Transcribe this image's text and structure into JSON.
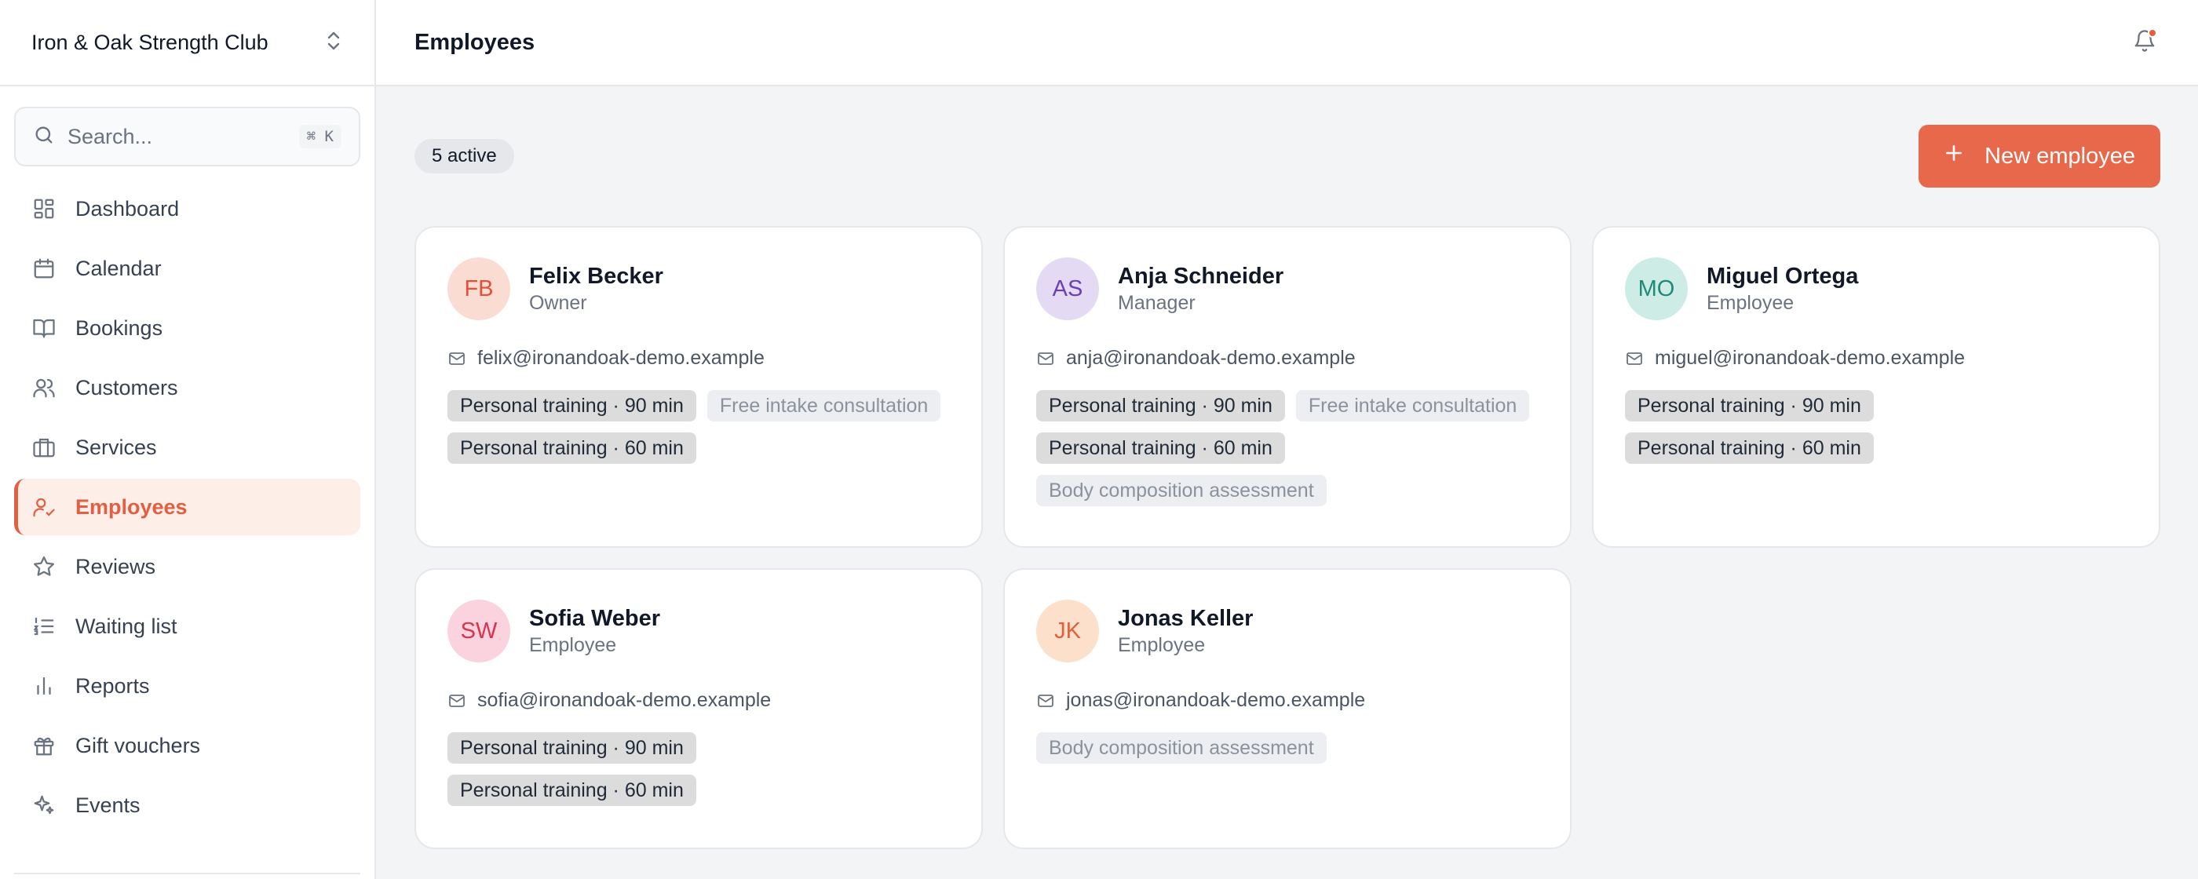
{
  "org": {
    "name": "Iron & Oak Strength Club"
  },
  "search": {
    "placeholder": "Search...",
    "shortcut": "⌘ K"
  },
  "nav": [
    {
      "label": "Dashboard",
      "icon": "dashboard-icon",
      "active": false
    },
    {
      "label": "Calendar",
      "icon": "calendar-icon",
      "active": false
    },
    {
      "label": "Bookings",
      "icon": "book-open-icon",
      "active": false
    },
    {
      "label": "Customers",
      "icon": "users-icon",
      "active": false
    },
    {
      "label": "Services",
      "icon": "briefcase-icon",
      "active": false
    },
    {
      "label": "Employees",
      "icon": "user-check-icon",
      "active": true
    },
    {
      "label": "Reviews",
      "icon": "star-icon",
      "active": false
    },
    {
      "label": "Waiting list",
      "icon": "list-ordered-icon",
      "active": false
    },
    {
      "label": "Reports",
      "icon": "bar-chart-icon",
      "active": false
    },
    {
      "label": "Gift vouchers",
      "icon": "gift-icon",
      "active": false
    },
    {
      "label": "Events",
      "icon": "sparkles-icon",
      "active": false
    }
  ],
  "header": {
    "title": "Employees",
    "notification_dot": true
  },
  "toolbar": {
    "active_count": "5 active",
    "new_label": "New employee"
  },
  "colors": {
    "accent": "#e8684b",
    "accent_bg": "#fdeee8"
  },
  "employees": [
    {
      "initials": "FB",
      "name": "Felix Becker",
      "role": "Owner",
      "email": "felix@ironandoak-demo.example",
      "avatar_bg": "#fbdcd3",
      "avatar_fg": "#e0513a",
      "services": [
        {
          "label": "Personal training · 90 min",
          "style": "strong"
        },
        {
          "label": "Free intake consultation",
          "style": "muted"
        },
        {
          "label": "Personal training · 60 min",
          "style": "strong"
        }
      ]
    },
    {
      "initials": "AS",
      "name": "Anja Schneider",
      "role": "Manager",
      "email": "anja@ironandoak-demo.example",
      "avatar_bg": "#e5daf3",
      "avatar_fg": "#6d3fb3",
      "services": [
        {
          "label": "Personal training · 90 min",
          "style": "strong"
        },
        {
          "label": "Free intake consultation",
          "style": "muted"
        },
        {
          "label": "Personal training · 60 min",
          "style": "strong"
        },
        {
          "label": "Body composition assessment",
          "style": "muted"
        }
      ]
    },
    {
      "initials": "MO",
      "name": "Miguel Ortega",
      "role": "Employee",
      "email": "miguel@ironandoak-demo.example",
      "avatar_bg": "#cdece6",
      "avatar_fg": "#1f8a78",
      "services": [
        {
          "label": "Personal training · 90 min",
          "style": "strong"
        },
        {
          "label": "Personal training · 60 min",
          "style": "strong"
        }
      ]
    },
    {
      "initials": "SW",
      "name": "Sofia Weber",
      "role": "Employee",
      "email": "sofia@ironandoak-demo.example",
      "avatar_bg": "#fbd3de",
      "avatar_fg": "#d8344f",
      "services": [
        {
          "label": "Personal training · 90 min",
          "style": "strong"
        },
        {
          "label": "Personal training · 60 min",
          "style": "strong"
        }
      ]
    },
    {
      "initials": "JK",
      "name": "Jonas Keller",
      "role": "Employee",
      "email": "jonas@ironandoak-demo.example",
      "avatar_bg": "#fde0cc",
      "avatar_fg": "#e0613a",
      "services": [
        {
          "label": "Body composition assessment",
          "style": "muted"
        }
      ]
    }
  ]
}
